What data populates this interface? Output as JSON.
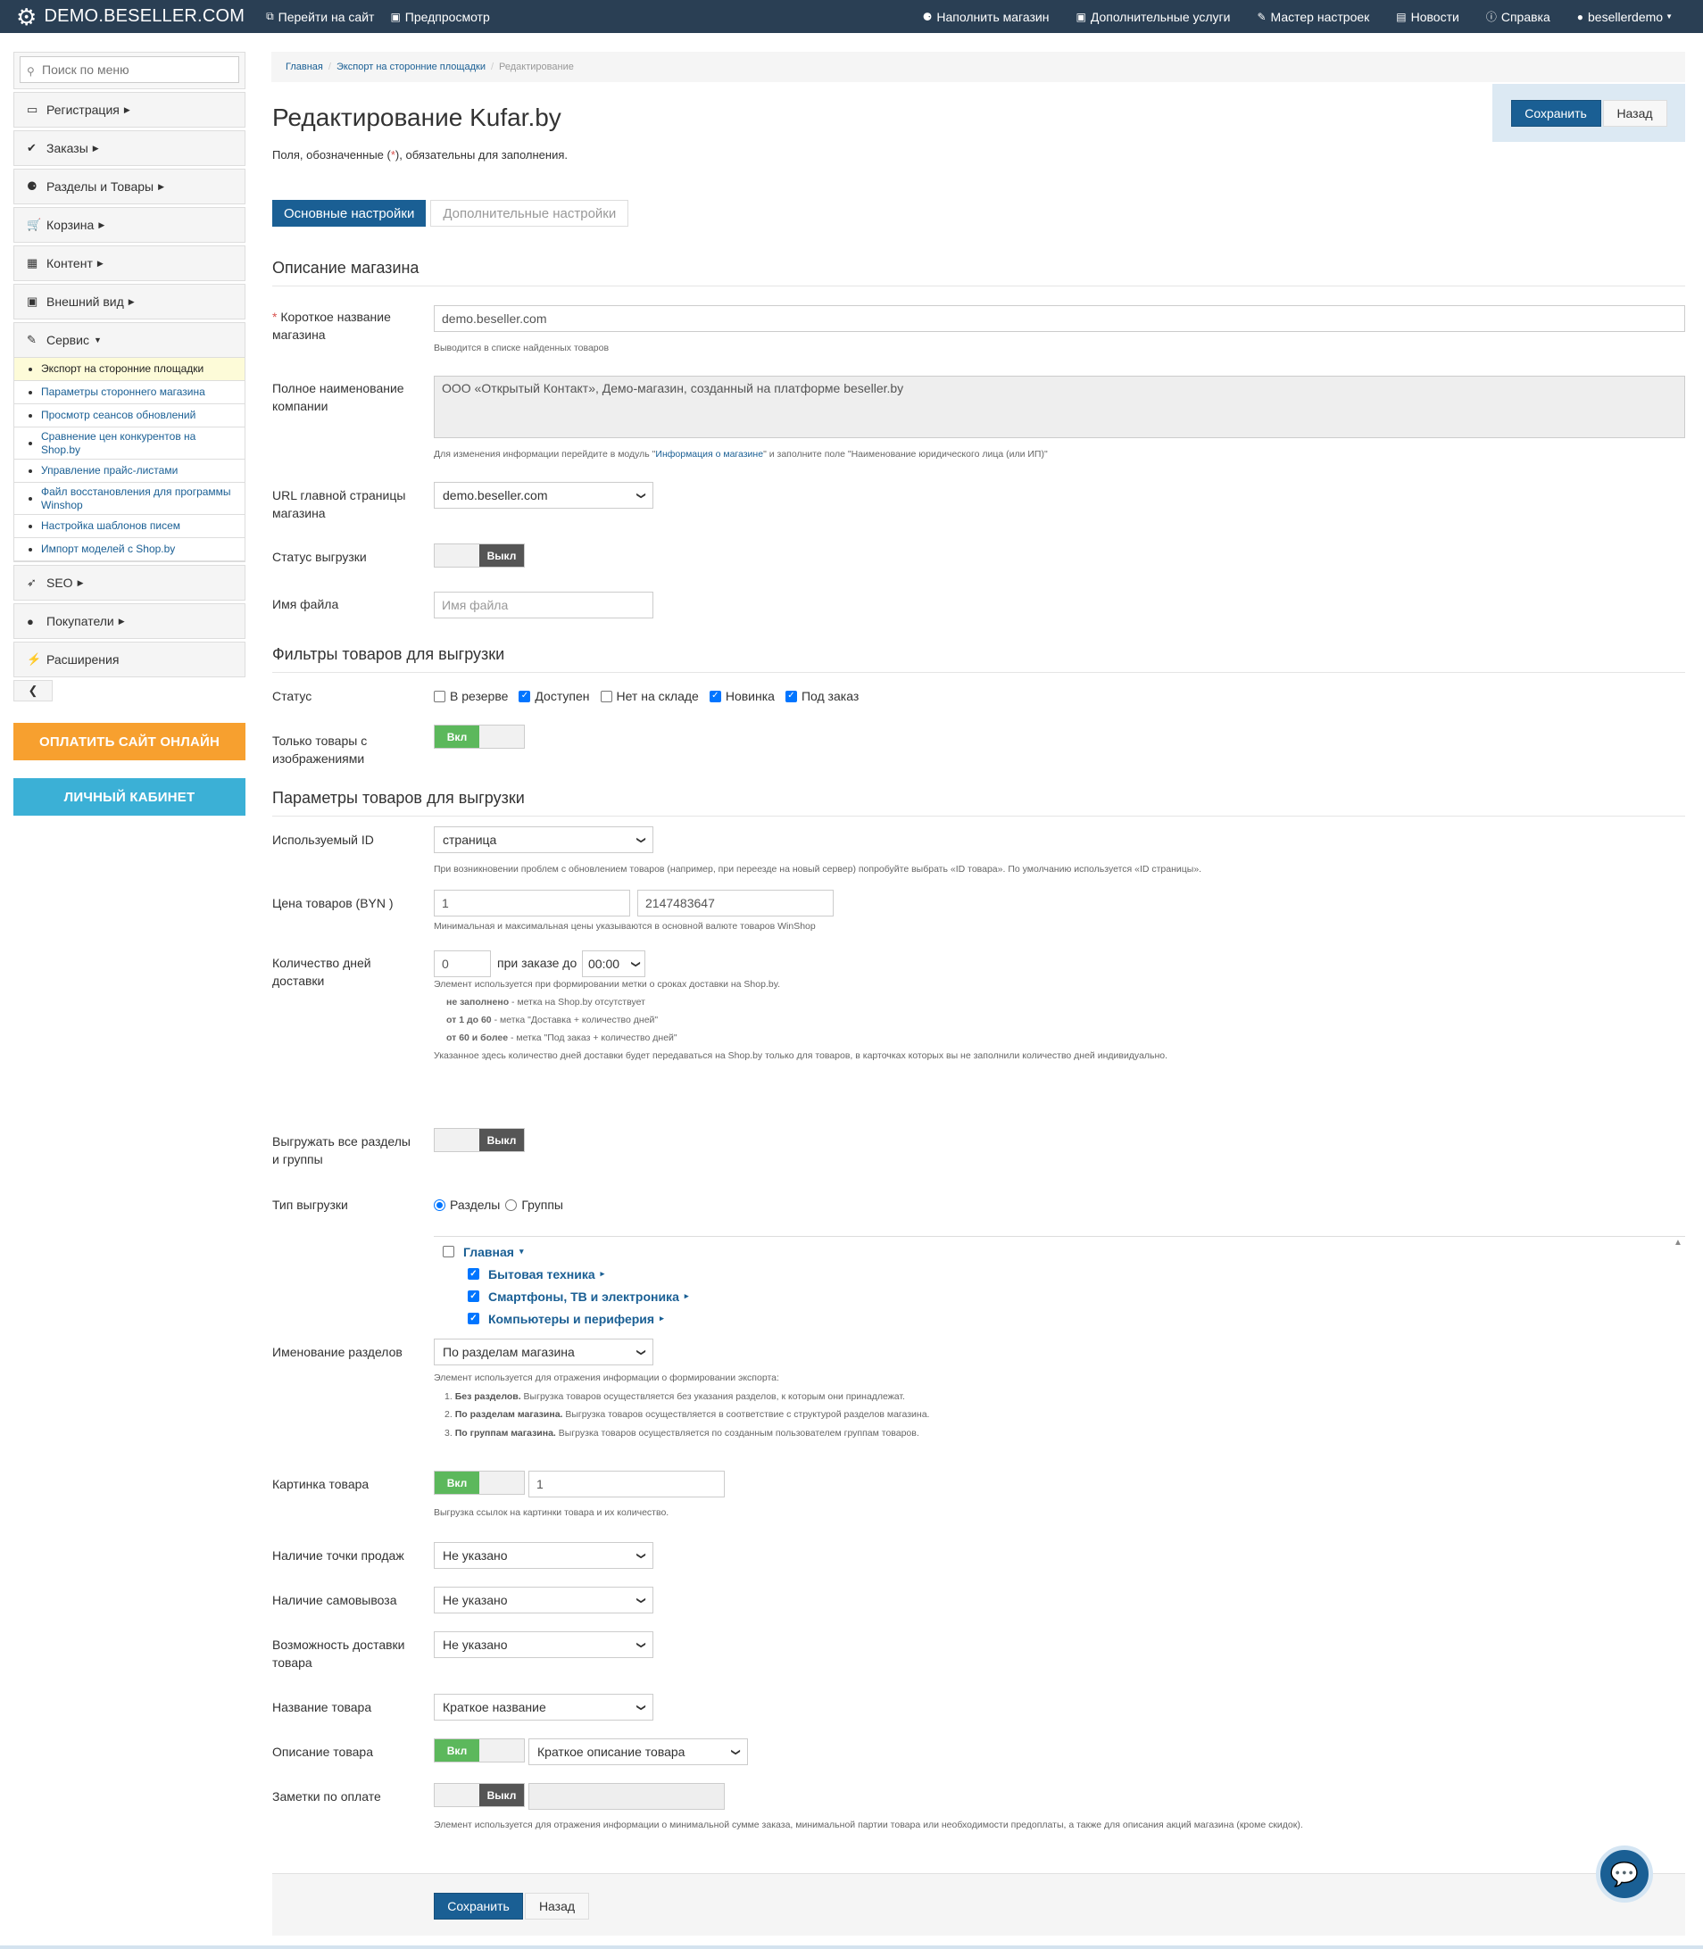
{
  "topbar": {
    "brand": "DEMO.BESELLER.COM",
    "left": [
      {
        "icon": "external-link-icon",
        "label": "Перейти на сайт"
      },
      {
        "icon": "preview-icon",
        "label": "Предпросмотр"
      }
    ],
    "right": [
      {
        "icon": "cubes-icon",
        "label": "Наполнить магазин"
      },
      {
        "icon": "money-icon",
        "label": "Дополнительные услуги"
      },
      {
        "icon": "wrench-icon",
        "label": "Мастер настроек"
      },
      {
        "icon": "news-icon",
        "label": "Новости"
      },
      {
        "icon": "info-icon",
        "label": "Справка"
      },
      {
        "icon": "user-icon",
        "label": "besellerdemo"
      }
    ]
  },
  "sidebar": {
    "search_placeholder": "Поиск по меню",
    "items": [
      {
        "label": "Регистрация",
        "icon": "briefcase-icon",
        "glyph": "▭"
      },
      {
        "label": "Заказы",
        "icon": "check-circle-icon",
        "glyph": "✔"
      },
      {
        "label": "Разделы и Товары",
        "icon": "cubes-icon",
        "glyph": "⚈"
      },
      {
        "label": "Корзина",
        "icon": "cart-icon",
        "glyph": "🛒"
      },
      {
        "label": "Контент",
        "icon": "grid-icon",
        "glyph": "▦"
      },
      {
        "label": "Внешний вид",
        "icon": "image-icon",
        "glyph": "▣"
      },
      {
        "label": "Сервис",
        "icon": "wrench-icon",
        "glyph": "✎"
      }
    ],
    "service_sub": [
      "Экспорт на сторонние площадки",
      "Параметры стороннего магазина",
      "Просмотр сеансов обновлений",
      "Сравнение цен конкурентов на Shop.by",
      "Управление прайс-листами",
      "Файл восстановления для программы Winshop",
      "Настройка шаблонов писем",
      "Импорт моделей с Shop.by"
    ],
    "items_after": [
      {
        "label": "SEO",
        "icon": "rocket-icon",
        "glyph": "➶",
        "caret": true
      },
      {
        "label": "Покупатели",
        "icon": "user-icon",
        "glyph": "●",
        "caret": true
      },
      {
        "label": "Расширения",
        "icon": "plug-icon",
        "glyph": "⚡",
        "caret": false
      }
    ],
    "pay_button": "ОПЛАТИТЬ САЙТ ОНЛАЙН",
    "cabinet_button": "ЛИЧНЫЙ КАБИНЕТ",
    "pay_color": "#f7a02f",
    "cabinet_color": "#3bb0d6"
  },
  "breadcrumb": {
    "home": "Главная",
    "parent": "Экспорт на сторонние площадки",
    "current": "Редактирование"
  },
  "actions": {
    "save": "Сохранить",
    "back": "Назад"
  },
  "page": {
    "title": "Редактирование Kufar.by",
    "req_note_a": "Поля, обозначенные (",
    "req_note_star": "*",
    "req_note_b": "), обязательны для заполнения."
  },
  "tabs": {
    "main": "Основные настройки",
    "extra": "Дополнительные настройки"
  },
  "section_shop": {
    "title": "Описание магазина",
    "short_name_label": "Короткое название магазина",
    "short_name_value": "demo.beseller.com",
    "short_name_help": "Выводится в списке найденных товаров",
    "full_name_label": "Полное наименование компании",
    "full_name_value": "ООО «Открытый Контакт», Демо-магазин, созданный на платформе beseller.by",
    "full_name_help_a": "Для изменения информации перейдите в модуль \"",
    "full_name_help_link": "Информация о магазине",
    "full_name_help_b": "\" и заполните поле \"Наименование юридического лица (или ИП)\"",
    "url_label": "URL главной страницы магазина",
    "url_value": "demo.beseller.com",
    "status_label": "Статус выгрузки",
    "status_value": "Выкл",
    "filename_label": "Имя файла",
    "filename_placeholder": "Имя файла"
  },
  "section_filters": {
    "title": "Фильтры товаров для выгрузки",
    "status_label": "Статус",
    "statuses": [
      {
        "label": "В резерве",
        "checked": false
      },
      {
        "label": "Доступен",
        "checked": true
      },
      {
        "label": "Нет на складе",
        "checked": false
      },
      {
        "label": "Новинка",
        "checked": true
      },
      {
        "label": "Под заказ",
        "checked": true
      }
    ],
    "images_only_label": "Только товары с изображениями",
    "images_only_value": "Вкл"
  },
  "section_params": {
    "title": "Параметры товаров для выгрузки",
    "id_label": "Используемый ID",
    "id_value": "страница",
    "id_help": "При возникновении проблем с обновлением товаров (например, при переезде на новый сервер) попробуйте выбрать «ID товара». По умолчанию используется «ID страницы».",
    "price_label": "Цена товаров (BYN )",
    "price_min": "1",
    "price_max": "2147483647",
    "price_help": "Минимальная и максимальная цены указываются в основной валюте товаров WinShop",
    "days_label": "Количество дней доставки",
    "days_value": "0",
    "order_until_label": "при заказе до",
    "order_until_value": "00:00",
    "days_help": "Элемент используется при формировании метки о сроках доставки на Shop.by.",
    "days_help_1b": "не заполнено",
    "days_help_1": " - метка на Shop.by отсутствует",
    "days_help_2b": "от 1 до 60",
    "days_help_2": " - метка \"Доставка + количество дней\"",
    "days_help_3b": "от 60 и более",
    "days_help_3": " - метка \"Под заказ + количество дней\"",
    "days_help_end": "Указанное здесь количество дней доставки будет передаваться на Shop.by только для товаров, в карточках которых вы не заполнили количество дней индивидуально.",
    "all_sections_label": "Выгружать все разделы и группы",
    "all_sections_value": "Выкл",
    "type_label": "Тип выгрузки",
    "type_options": [
      {
        "label": "Разделы",
        "checked": true
      },
      {
        "label": "Группы",
        "checked": false
      }
    ],
    "tree": [
      {
        "label": "Главная",
        "checked": false,
        "level": 0,
        "caret": "▾"
      },
      {
        "label": "Бытовая техника",
        "checked": true,
        "level": 1,
        "caret": "▸"
      },
      {
        "label": "Смартфоны, ТВ и электроника",
        "checked": true,
        "level": 1,
        "caret": "▸"
      },
      {
        "label": "Компьютеры и периферия",
        "checked": true,
        "level": 1,
        "caret": "▸"
      }
    ],
    "naming_label": "Именование разделов",
    "naming_value": "По разделам магазина",
    "naming_help": "Элемент используется для отражения информации о формировании экспорта:",
    "naming_1b": "Без разделов.",
    "naming_1": " Выгрузка товаров осуществляется без указания разделов, к которым они принадлежат.",
    "naming_2b": "По разделам магазина.",
    "naming_2": " Выгрузка товаров осуществляется в соответствие с структурой разделов магазина.",
    "naming_3b": "По группам магазина.",
    "naming_3": " Выгрузка товаров осуществляется по созданным пользователем группам товаров.",
    "picture_label": "Картинка товара",
    "picture_toggle": "Вкл",
    "picture_count": "1",
    "picture_help": "Выгрузка ссылок на картинки товара и их количество.",
    "sale_point_label": "Наличие точки продаж",
    "sale_point_value": "Не указано",
    "pickup_label": "Наличие самовывоза",
    "pickup_value": "Не указано",
    "delivery_label": "Возможность доставки товара",
    "delivery_value": "Не указано",
    "name_label": "Название товара",
    "name_value": "Краткое название",
    "desc_label": "Описание товара",
    "desc_toggle": "Вкл",
    "desc_value": "Краткое описание товара",
    "payment_label": "Заметки по оплате",
    "payment_toggle": "Выкл",
    "payment_help": "Элемент используется для отражения информации о минимальной сумме заказа, минимальной партии товара или необходимости предоплаты, а также для описания акций магазина (кроме скидок)."
  },
  "footer_actions": {
    "save": "Сохранить",
    "back": "Назад"
  }
}
